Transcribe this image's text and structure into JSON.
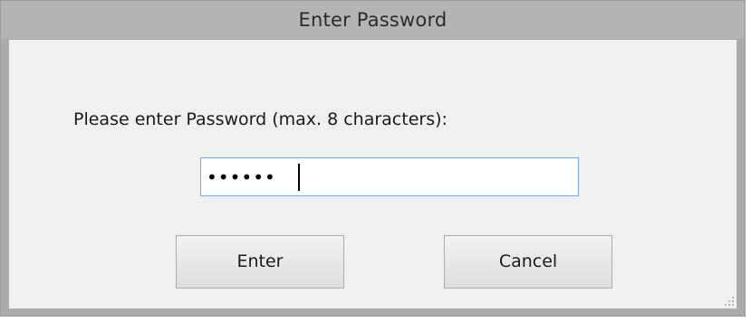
{
  "dialog": {
    "title": "Enter Password",
    "prompt": "Please enter Password (max. 8 characters):",
    "password_value": "••••••",
    "buttons": {
      "enter_label": "Enter",
      "cancel_label": "Cancel"
    }
  },
  "icons": {
    "resize_grip": "resize-grip-icon"
  },
  "colors": {
    "titlebar": "#b4b4b4",
    "client_background": "#f0f0f0",
    "input_focus_border": "#7aa7e0"
  }
}
